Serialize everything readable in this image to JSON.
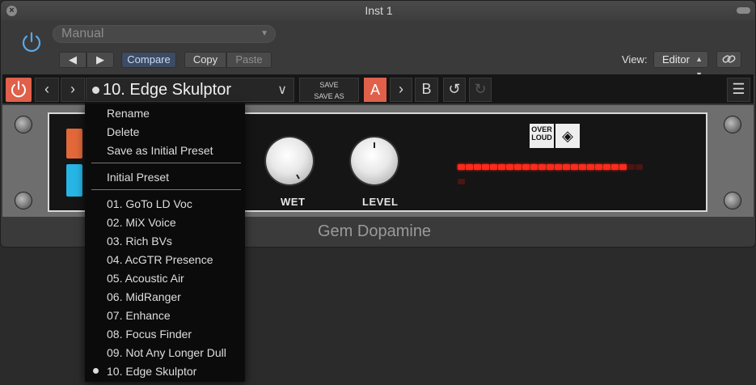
{
  "window": {
    "title": "Inst 1"
  },
  "host": {
    "preset": "Manual",
    "prev_label": "◀",
    "next_label": "▶",
    "compare_label": "Compare",
    "copy_label": "Copy",
    "paste_label": "Paste",
    "view_label": "View:",
    "view_value": "Editor"
  },
  "plugin_toolbar": {
    "preset_name": "10. Edge Skulptor",
    "save_label": "SAVE",
    "save_as_label": "SAVE AS",
    "a_label": "A",
    "b_label": "B"
  },
  "plugin": {
    "knob_wet_label": "WET",
    "knob_level_label": "LEVEL",
    "logo_text": "OVER LOUD",
    "product_name": "Gem Dopamine",
    "meter_level_fraction": 0.89
  },
  "menu": {
    "actions": [
      "Rename",
      "Delete",
      "Save as Initial Preset"
    ],
    "initial": "Initial Preset",
    "presets": [
      "01. GoTo LD Voc",
      "02. MiX Voice",
      "03. Rich BVs",
      "04. AcGTR Presence",
      "05. Acoustic Air",
      "06. MidRanger",
      "07. Enhance",
      "08. Focus Finder",
      "09. Not Any Longer Dull",
      "10. Edge Skulptor"
    ],
    "selected_index": 9
  },
  "colors": {
    "accent_red": "#e0604a",
    "compare_blue": "#3d4b63",
    "led_red": "#ff2a1a",
    "orange_button": "#e2683a",
    "cyan_button": "#27b5e6"
  }
}
